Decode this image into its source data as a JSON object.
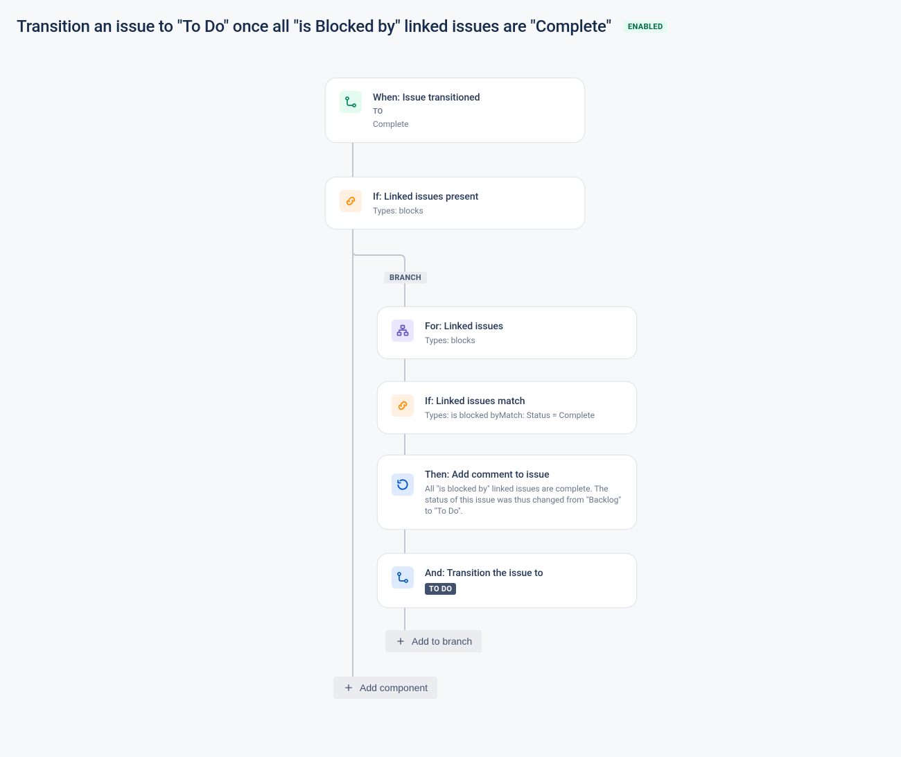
{
  "header": {
    "title": "Transition an issue to \"To Do\" once all \"is Blocked by\" linked issues are \"Complete\"",
    "status_badge": "ENABLED"
  },
  "flow": {
    "trigger": {
      "title": "When: Issue transitioned",
      "sub1": "TO",
      "sub2": "Complete"
    },
    "condition1": {
      "title": "If: Linked issues present",
      "sub": "Types: blocks"
    },
    "branch_label": "BRANCH",
    "branch": {
      "for": {
        "title": "For: Linked issues",
        "sub": "Types: blocks"
      },
      "if": {
        "title": "If: Linked issues match",
        "sub": "Types: is blocked byMatch: Status = Complete"
      },
      "then_comment": {
        "title": "Then: Add comment to issue",
        "sub": "All \"is blocked by\" linked issues are complete. The status of this issue was thus changed from \"Backlog\" to \"To Do\"."
      },
      "and_transition": {
        "title": "And: Transition the issue to",
        "lozenge": "TO DO"
      }
    },
    "add_to_branch": "Add to branch",
    "add_component": "Add component"
  }
}
